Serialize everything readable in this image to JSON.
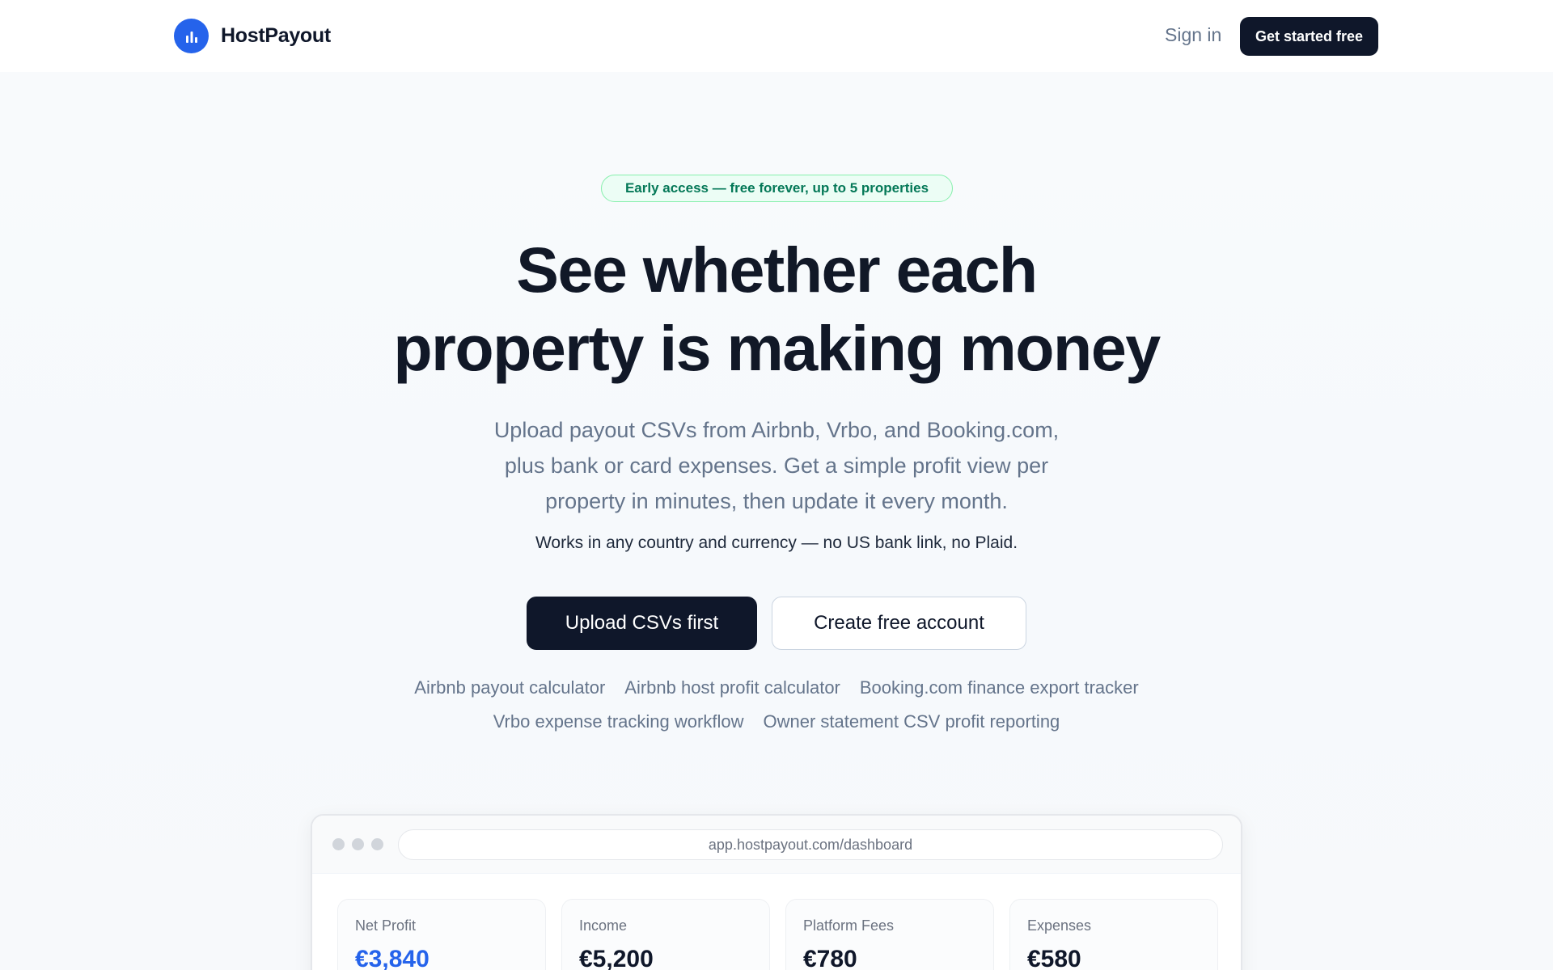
{
  "header": {
    "brand": "HostPayout",
    "sign_in": "Sign in",
    "cta": "Get started free"
  },
  "hero": {
    "badge": "Early access — free forever, up to 5 properties",
    "headline_line1": "See whether each",
    "headline_line2": "property is making money",
    "subtitle_line1": "Upload payout CSVs from Airbnb, Vrbo, and Booking.com,",
    "subtitle_line2": "plus bank or card expenses. Get a simple profit view per",
    "subtitle_line3": "property in minutes, then update it every month.",
    "note": "Works in any country and currency — no US bank link, no Plaid.",
    "primary_button": "Upload CSVs first",
    "secondary_button": "Create free account",
    "links": [
      "Airbnb payout calculator",
      "Airbnb host profit calculator",
      "Booking.com finance export tracker",
      "Vrbo expense tracking workflow",
      "Owner statement CSV profit reporting"
    ]
  },
  "preview": {
    "url": "app.hostpayout.com/dashboard",
    "cards": [
      {
        "label": "Net Profit",
        "value": "€3,840"
      },
      {
        "label": "Income",
        "value": "€5,200"
      },
      {
        "label": "Platform Fees",
        "value": "€780"
      },
      {
        "label": "Expenses",
        "value": "€580"
      }
    ]
  },
  "colors": {
    "accent": "#2563eb",
    "primary_dark": "#0f172a",
    "badge_green": "#047857"
  },
  "icons": {
    "logo": "bar-chart-icon"
  }
}
